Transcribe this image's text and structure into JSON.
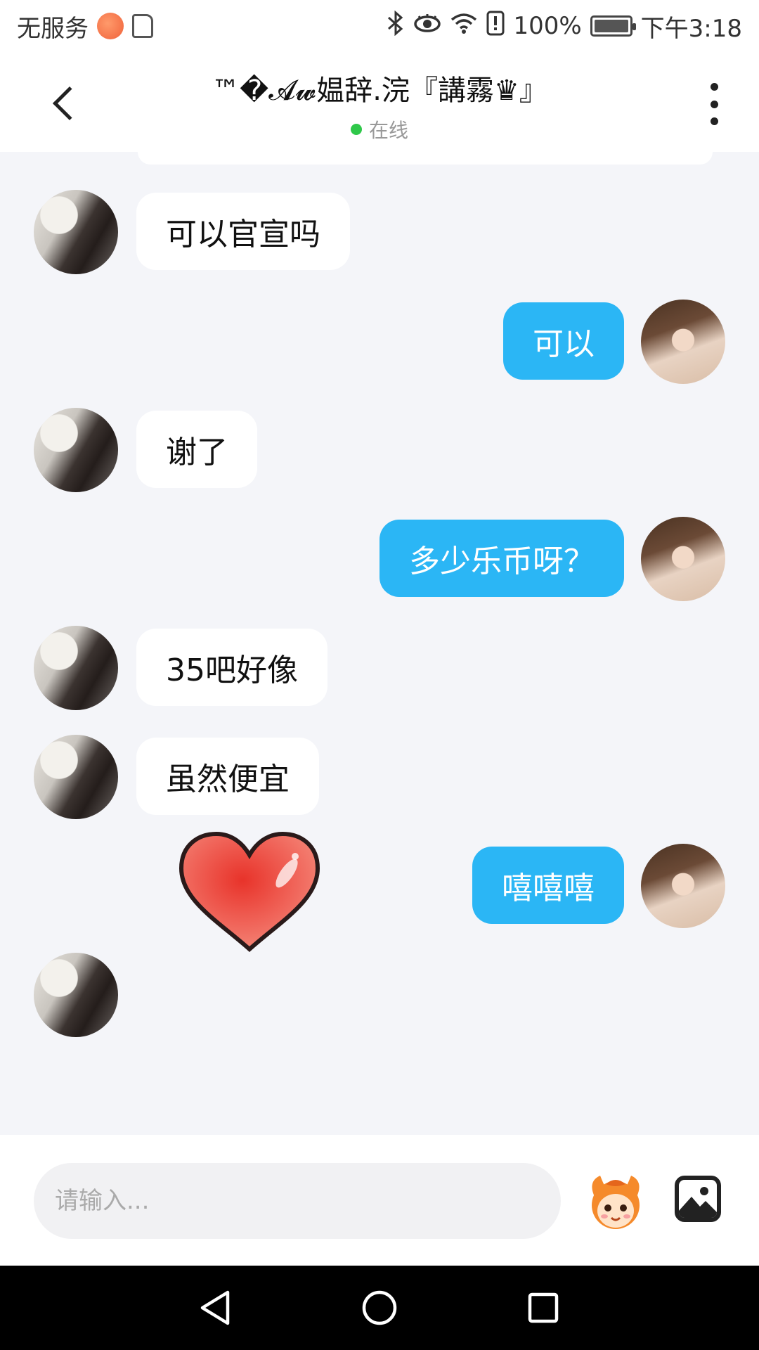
{
  "status_bar": {
    "carrier": "无服务",
    "battery": "100%",
    "time": "下午3:18",
    "battery_level": 1.0,
    "icons": [
      "app-notification-icon",
      "sim-icon",
      "bluetooth-icon",
      "eye-comfort-icon",
      "wifi-icon",
      "alert-icon",
      "battery-icon"
    ]
  },
  "header": {
    "title": "™�𝓐𝔀媪辞.浣『講霧♛』",
    "status": "在线",
    "online_color": "#2fc84a"
  },
  "messages": [
    {
      "side": "in",
      "text": "可以官宣吗"
    },
    {
      "side": "out",
      "text": "可以"
    },
    {
      "side": "in",
      "text": "谢了"
    },
    {
      "side": "out",
      "text": "多少乐币呀？"
    },
    {
      "side": "in",
      "text": "35吧好像"
    },
    {
      "side": "in",
      "text": "虽然便宜"
    },
    {
      "side": "out",
      "text": "嘻嘻嘻"
    },
    {
      "side": "in",
      "sticker": "heart-sticker"
    }
  ],
  "input": {
    "placeholder": "请输入..."
  },
  "colors": {
    "outgoing_bubble": "#2bb6f5",
    "incoming_bubble": "#ffffff",
    "chat_background": "#f4f5f9"
  }
}
